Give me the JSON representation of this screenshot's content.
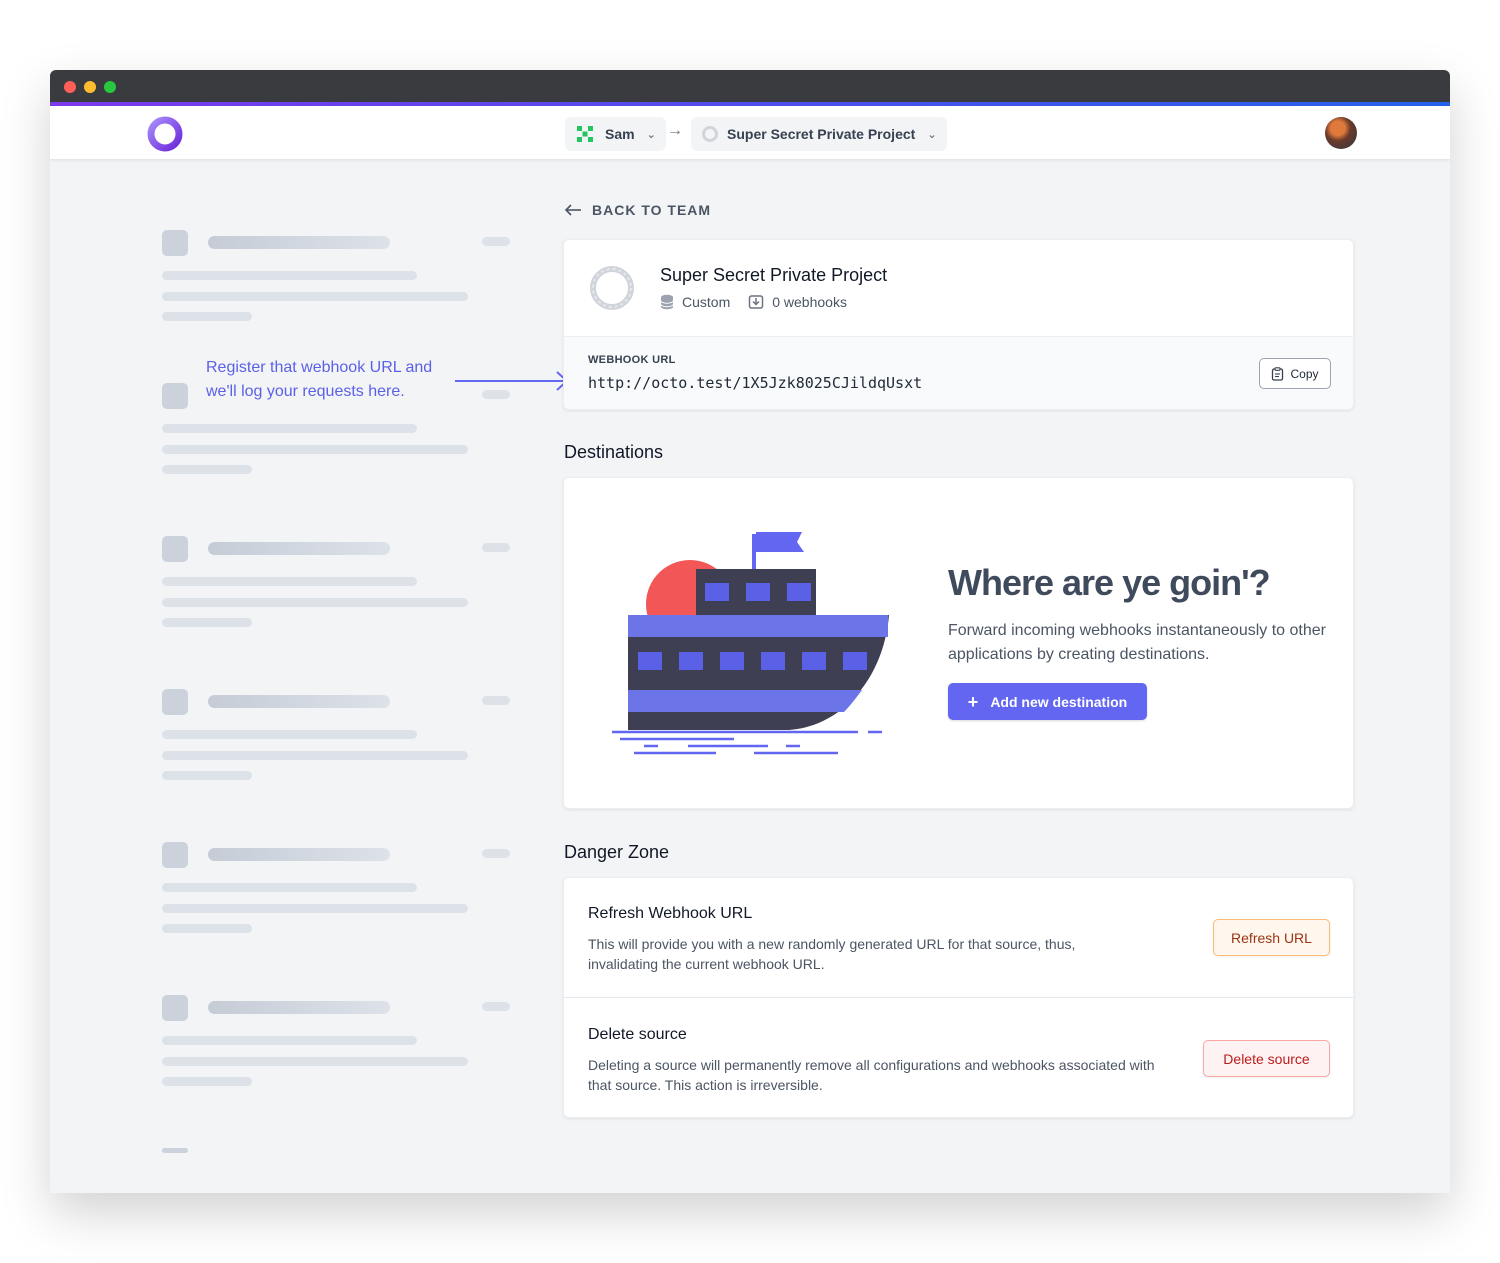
{
  "nav": {
    "team": "Sam",
    "project": "Super Secret Private Project"
  },
  "annotation": "Register that webhook URL and we'll log your requests here.",
  "back_label": "BACK TO TEAM",
  "project": {
    "title": "Super Secret Private Project",
    "type": "Custom",
    "webhooks": "0 webhooks",
    "url_label": "WEBHOOK URL",
    "url": "http://octo.test/1X5Jzk8025CJildqUsxt",
    "copy_label": "Copy"
  },
  "destinations": {
    "section_title": "Destinations",
    "empty_title": "Where are ye goin'?",
    "empty_desc": "Forward incoming webhooks instantaneously to other applications by creating destinations.",
    "add_label": "Add new destination"
  },
  "danger": {
    "section_title": "Danger Zone",
    "refresh_title": "Refresh Webhook URL",
    "refresh_desc": "This will provide you with a new randomly generated URL for that source, thus, invalidating the current webhook URL.",
    "refresh_button": "Refresh URL",
    "delete_title": "Delete source",
    "delete_desc": "Deleting a source will permanently remove all configurations and webhooks associated with that source. This action is irreversible.",
    "delete_button": "Delete source"
  },
  "colors": {
    "accent": "#6366f1",
    "refresh": "#9a3412",
    "delete": "#b91c1c"
  }
}
